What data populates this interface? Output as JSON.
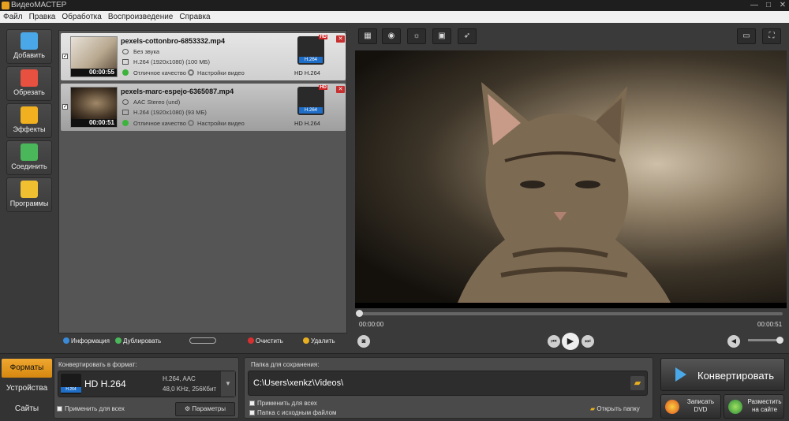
{
  "window": {
    "title": "ВидеоМАСТЕР",
    "controls": [
      "—",
      "□",
      "✕"
    ]
  },
  "menu": [
    "Файл",
    "Правка",
    "Обработка",
    "Воспроизведение",
    "Справка"
  ],
  "sidebar": [
    {
      "label": "Добавить",
      "icon": "add-file-icon",
      "color": "#4aa8e8"
    },
    {
      "label": "Обрезать",
      "icon": "cut-icon",
      "color": "#e85040"
    },
    {
      "label": "Эффекты",
      "icon": "effects-icon",
      "color": "#f0b020"
    },
    {
      "label": "Соединить",
      "icon": "join-icon",
      "color": "#4ab85a"
    },
    {
      "label": "Программы",
      "icon": "programs-icon",
      "color": "#f0c030"
    }
  ],
  "files": [
    {
      "name": "pexels-cottonbro-6853332.mp4",
      "audio": "Без звука",
      "video": "H.264 (1920x1080) (100 МБ)",
      "duration": "00:00:55",
      "quality": "Отличное качество",
      "settings": "Настройки видео",
      "format": "HD H.264",
      "badge": "H.264",
      "hd": "HD"
    },
    {
      "name": "pexels-marc-espejo-6365087.mp4",
      "audio": "AAC Stereo (und)",
      "video": "H.264 (1920x1080) (93 МБ)",
      "duration": "00:00:51",
      "quality": "Отличное качество",
      "settings": "Настройки видео",
      "format": "HD H.264",
      "badge": "H.264",
      "hd": "HD"
    }
  ],
  "listbar": {
    "info": "Информация",
    "duplicate": "Дублировать",
    "clear": "Очистить",
    "delete": "Удалить"
  },
  "preview_tools": [
    "crop-icon",
    "stabilize-icon",
    "brightness-icon",
    "rotate-icon",
    "speed-icon"
  ],
  "player": {
    "current": "00:00:00",
    "total": "00:00:51",
    "progress": 0.0,
    "volume": 0.85
  },
  "tabs": [
    "Форматы",
    "Устройства",
    "Сайты"
  ],
  "format_panel": {
    "title": "Конвертировать в формат:",
    "format": "HD H.264",
    "badge": "H.264",
    "codec": "H.264, AAC",
    "audio": "48,0 KHz, 256Кбит",
    "apply_all": "Применить для всех",
    "params": "Параметры"
  },
  "save_panel": {
    "title": "Папка для сохранения:",
    "path": "C:\\Users\\xenkz\\Videos\\",
    "apply_all": "Применить для всех",
    "source_folder": "Папка с исходным файлом",
    "open_folder": "Открыть папку"
  },
  "actions": {
    "convert": "Конвертировать",
    "dvd_line1": "Записать",
    "dvd_line2": "DVD",
    "web_line1": "Разместить",
    "web_line2": "на сайте"
  }
}
